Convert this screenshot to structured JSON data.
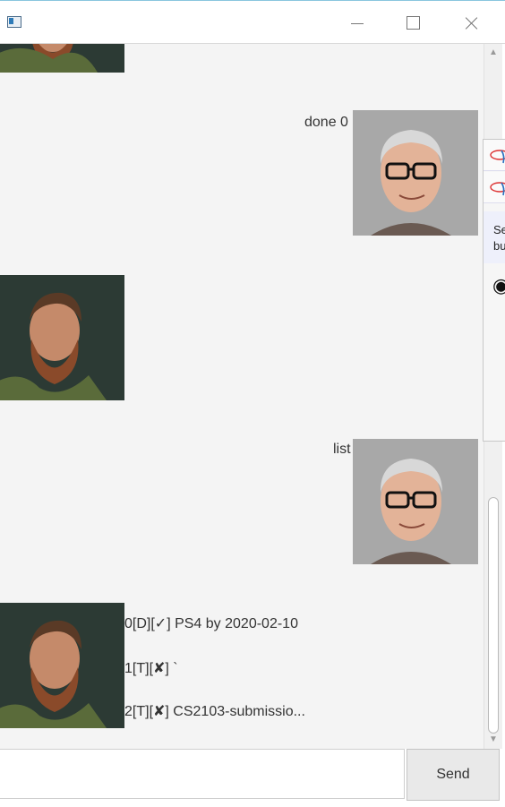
{
  "window": {
    "title": ""
  },
  "messages": [
    {
      "side": "bot",
      "text": ""
    },
    {
      "side": "user",
      "text": "done 0"
    },
    {
      "side": "bot",
      "text": ""
    },
    {
      "side": "user",
      "text": "list"
    },
    {
      "side": "bot",
      "lines": [
        "0[D][✓] PS4  by 2020-02-10",
        "1[T][✘] `",
        "2[T][✘] CS2103-submissio..."
      ]
    }
  ],
  "popup": {
    "text_line1": "Se",
    "text_line2": "bu"
  },
  "input": {
    "value": "",
    "placeholder": ""
  },
  "send_label": "Send",
  "colors": {
    "chat_bg": "#f4f4f4",
    "button_bg": "#e9e9e9"
  },
  "icons": {
    "minimize": "minimize-icon",
    "maximize": "maximize-icon",
    "close": "close-icon"
  }
}
